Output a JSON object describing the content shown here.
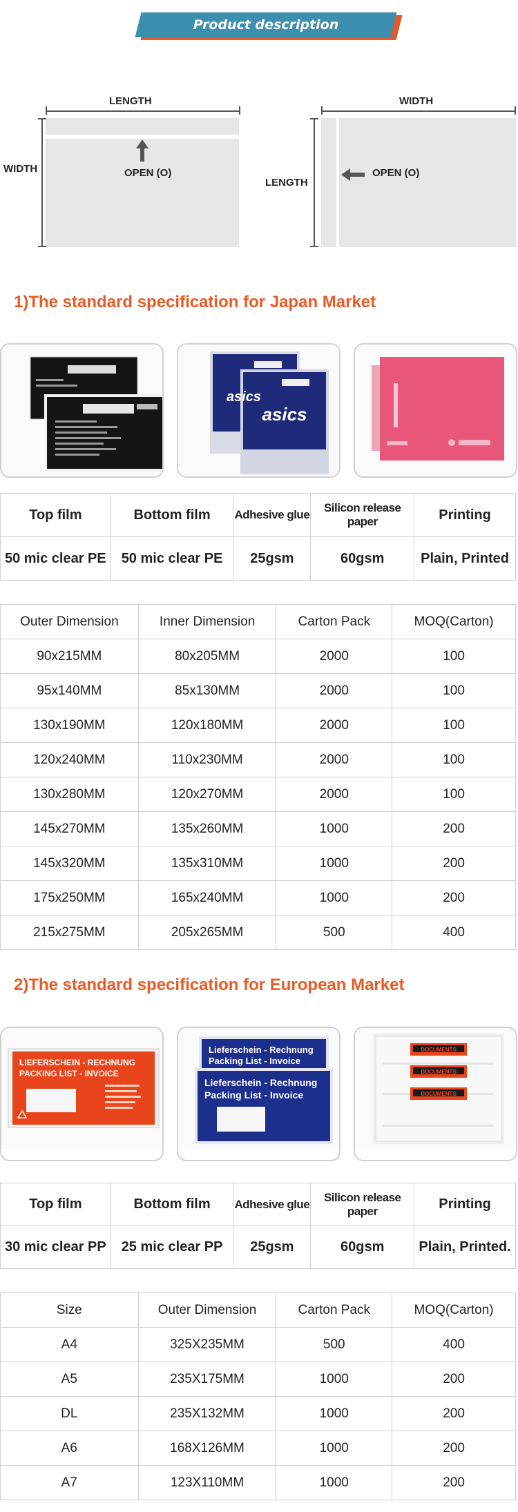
{
  "banner": {
    "title": "Product description"
  },
  "diagram": {
    "left": {
      "length": "LENGTH",
      "width": "WIDTH",
      "open": "OPEN (O)"
    },
    "right": {
      "width": "WIDTH",
      "length": "LENGTH",
      "open": "OPEN (O)"
    }
  },
  "japan": {
    "title": "1)The standard specification for Japan Market",
    "spec": {
      "headers": [
        "Top film",
        "Bottom film",
        "Adhesive glue",
        "Silicon release paper",
        "Printing"
      ],
      "values": [
        "50 mic clear PE",
        "50 mic clear PE",
        "25gsm",
        "60gsm",
        "Plain, Printed"
      ]
    },
    "dim_headers": [
      "Outer Dimension",
      "Inner Dimension",
      "Carton Pack",
      "MOQ(Carton)"
    ],
    "dim_rows": [
      [
        "90x215MM",
        "80x205MM",
        "2000",
        "100"
      ],
      [
        "95x140MM",
        "85x130MM",
        "2000",
        "100"
      ],
      [
        "130x190MM",
        "120x180MM",
        "2000",
        "100"
      ],
      [
        "120x240MM",
        "110x230MM",
        "2000",
        "100"
      ],
      [
        "130x280MM",
        "120x270MM",
        "2000",
        "100"
      ],
      [
        "145x270MM",
        "135x260MM",
        "1000",
        "200"
      ],
      [
        "145x320MM",
        "135x310MM",
        "1000",
        "200"
      ],
      [
        "175x250MM",
        "165x240MM",
        "1000",
        "200"
      ],
      [
        "215x275MM",
        "205x265MM",
        "500",
        "400"
      ]
    ],
    "photo_text": {
      "brand": "asics"
    }
  },
  "europe": {
    "title": "2)The standard specification for European Market",
    "spec": {
      "headers": [
        "Top film",
        "Bottom film",
        "Adhesive glue",
        "Silicon release paper",
        "Printing"
      ],
      "values": [
        "30 mic clear PP",
        "25 mic clear PP",
        "25gsm",
        "60gsm",
        "Plain, Printed."
      ]
    },
    "dim_headers": [
      "Size",
      "Outer Dimension",
      "Carton Pack",
      "MOQ(Carton)"
    ],
    "dim_rows": [
      [
        "A4",
        "325X235MM",
        "500",
        "400"
      ],
      [
        "A5",
        "235X175MM",
        "1000",
        "200"
      ],
      [
        "DL",
        "235X132MM",
        "1000",
        "200"
      ],
      [
        "A6",
        "168X126MM",
        "1000",
        "200"
      ],
      [
        "A7",
        "123X110MM",
        "1000",
        "200"
      ]
    ],
    "photo_text": {
      "orange_line1": "LIEFERSCHEIN - RECHNUNG",
      "orange_line2": "PACKING LIST - INVOICE",
      "blue_line1": "Lieferschein - Rechnung",
      "blue_line2": "Packing List - Invoice",
      "documents": "DOCUMENTS"
    }
  },
  "colors": {
    "accent": "#ec5a24",
    "banner": "#3c8fae",
    "navy": "#1f2a7a",
    "pink": "#e8567a"
  }
}
